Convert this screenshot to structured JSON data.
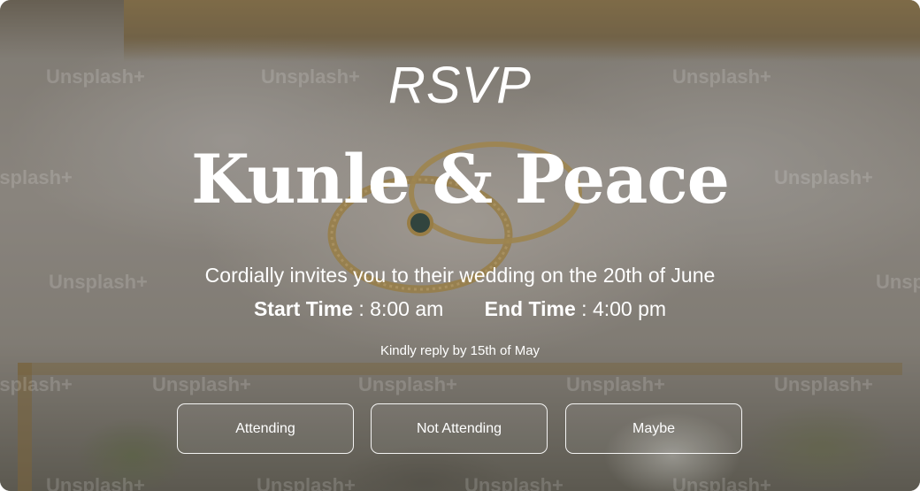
{
  "header": {
    "eyebrow": "RSVP",
    "couple": "Kunle & Peace"
  },
  "details": {
    "invitation": "Cordially invites you to their wedding on the 20th of June",
    "start_label": "Start Time",
    "start_value": "8:00 am",
    "end_label": "End Time",
    "end_value": "4:00 pm",
    "separator": " : ",
    "reply_by": "Kindly reply by 15th of May"
  },
  "actions": {
    "attending": "Attending",
    "not_attending": "Not Attending",
    "maybe": "Maybe"
  },
  "background": {
    "watermark": "Unsplash+"
  }
}
